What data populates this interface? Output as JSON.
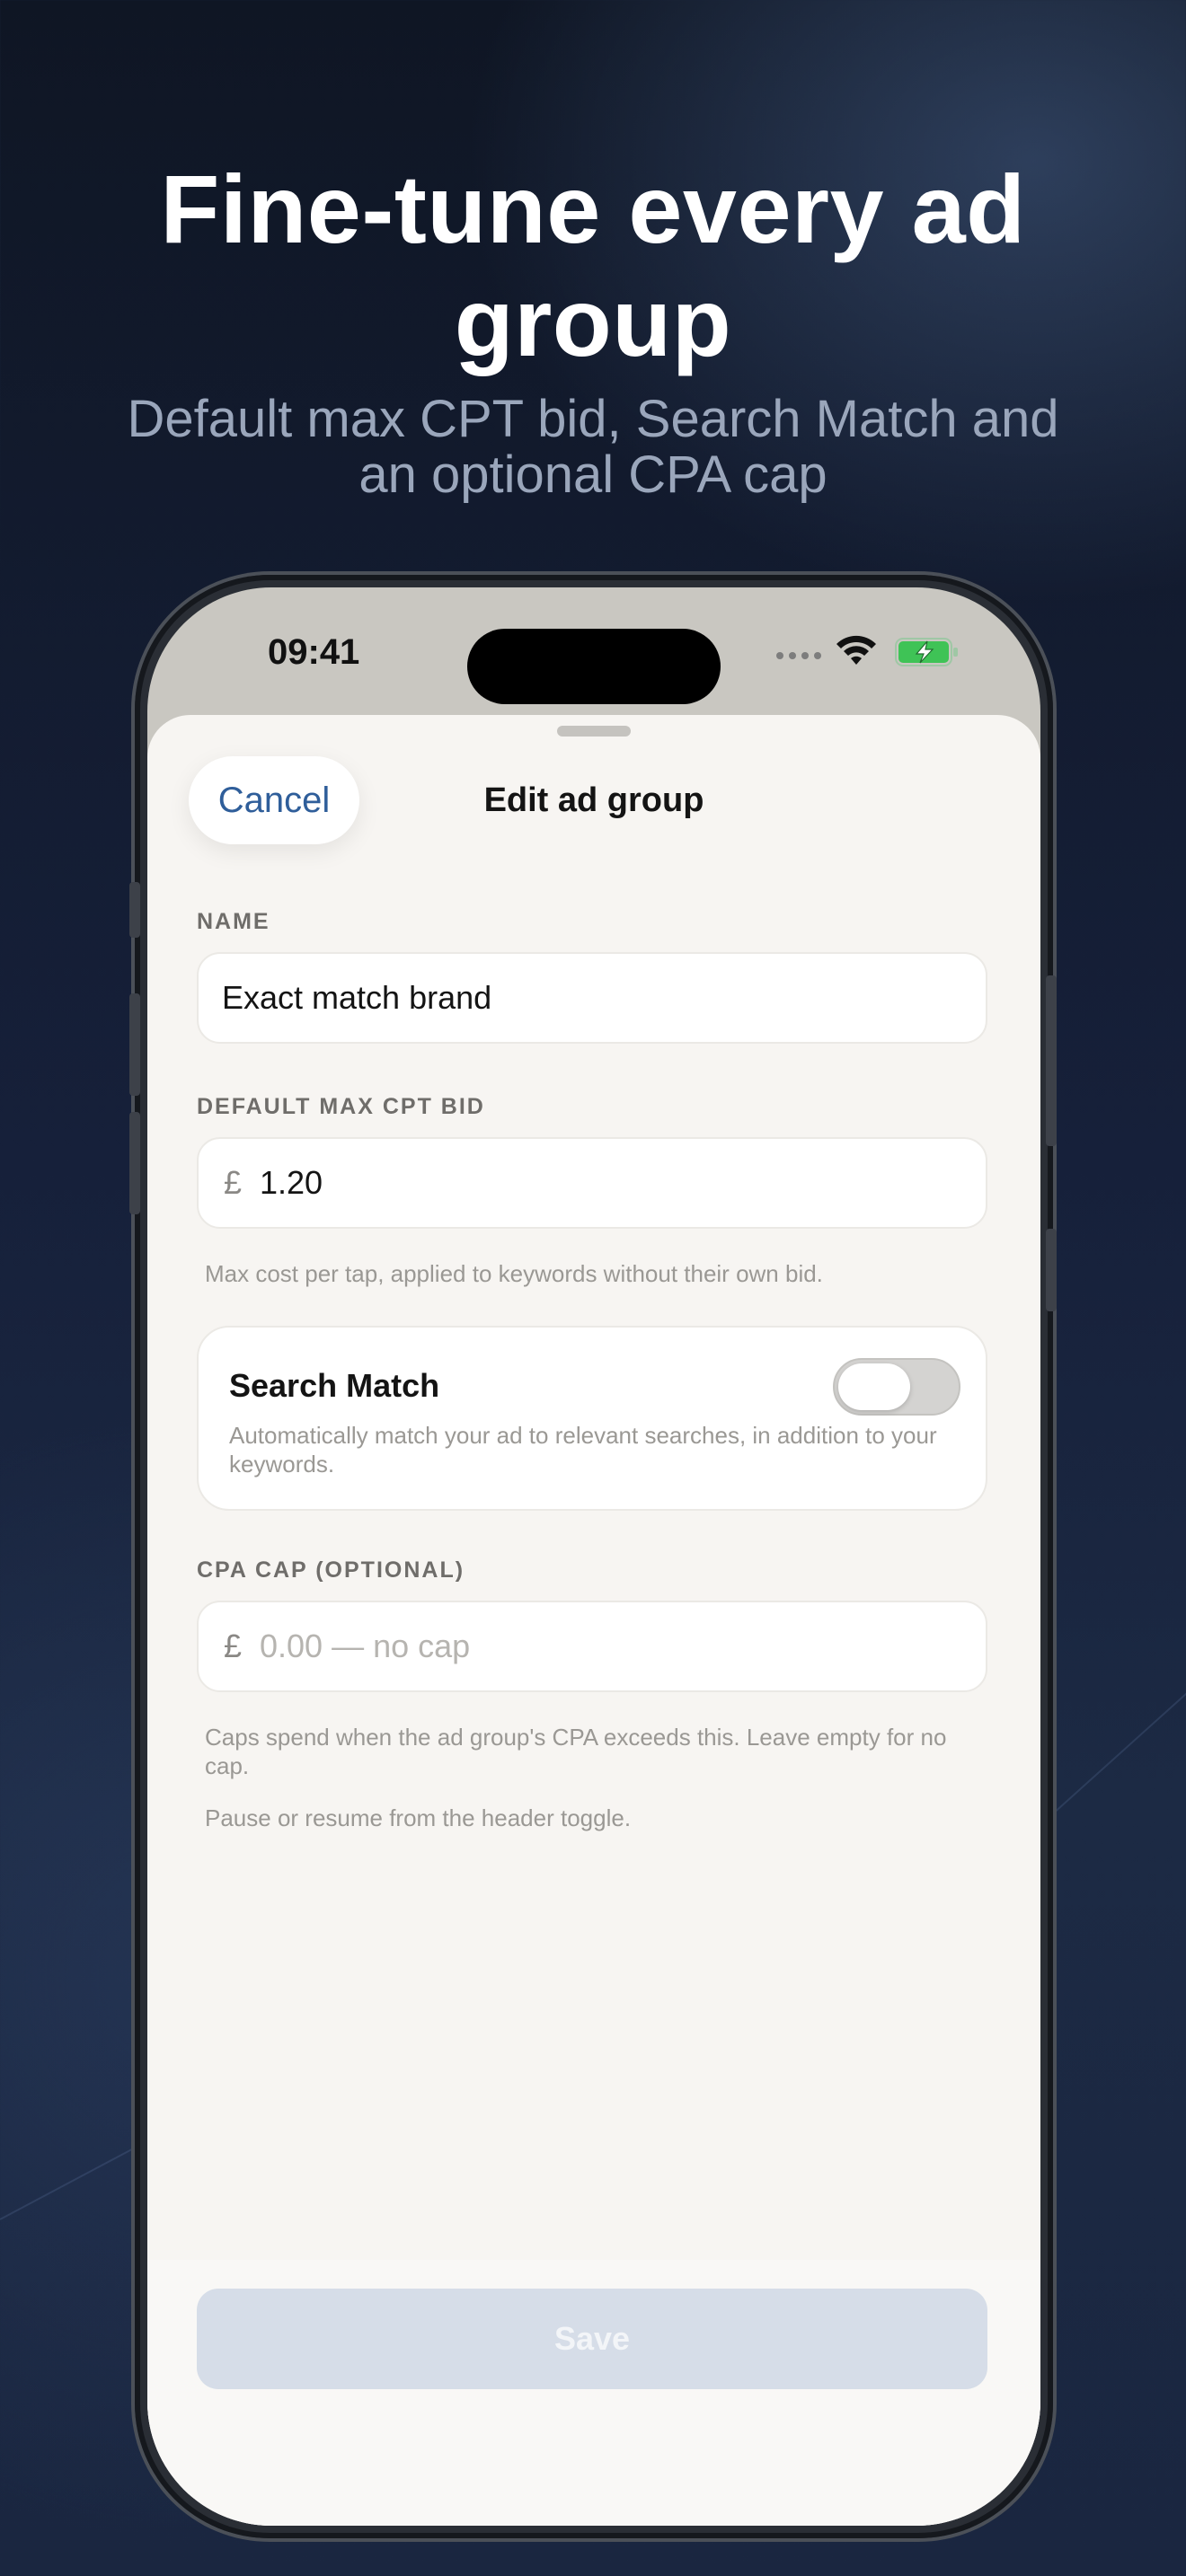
{
  "promo": {
    "headline_line1": "Fine-tune every ad",
    "headline_line2": "group",
    "subline_line1": "Default max CPT bid, Search Match and",
    "subline_line2": "an optional CPA cap"
  },
  "status_bar": {
    "time": "09:41",
    "battery_state": "charging",
    "icons": [
      "signal-dots-icon",
      "wifi-icon",
      "battery-charging-icon"
    ]
  },
  "sheet": {
    "cancel_label": "Cancel",
    "title": "Edit ad group",
    "name": {
      "label": "NAME",
      "value": "Exact match brand"
    },
    "bid": {
      "label": "DEFAULT MAX CPT BID",
      "currency": "£",
      "value": "1.20",
      "hint": "Max cost per tap, applied to keywords without their own bid."
    },
    "search_match": {
      "title": "Search Match",
      "description": "Automatically match your ad to relevant searches, in addition to your keywords.",
      "enabled": false
    },
    "cpa_cap": {
      "label": "CPA CAP (OPTIONAL)",
      "currency": "£",
      "placeholder": "0.00 — no cap",
      "hint": "Caps spend when the ad group's CPA exceeds this. Leave empty for no cap."
    },
    "pause_hint": "Pause or resume from the header toggle.",
    "save_label": "Save"
  },
  "colors": {
    "accent": "#2f5e9a",
    "battery_green": "#3fc356",
    "save_disabled_bg": "#d6dde8"
  }
}
